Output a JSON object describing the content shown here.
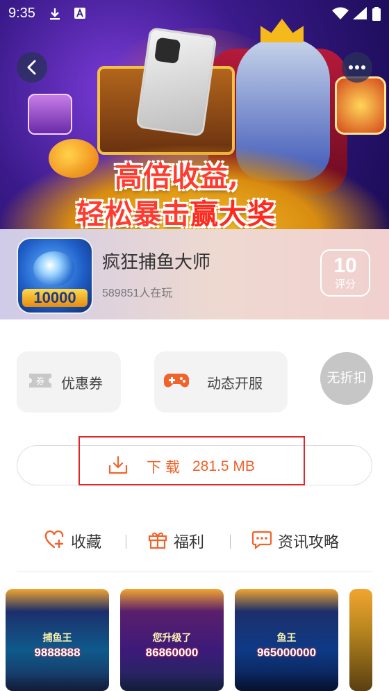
{
  "status_bar": {
    "time": "9:35"
  },
  "hero": {
    "slogan_line1": "高倍收益,",
    "slogan_line2_a": "轻松暴击",
    "slogan_line2_b": "赢大奖"
  },
  "app": {
    "name": "疯狂捕鱼大师",
    "players": "589851人在玩",
    "icon_badge": "10000",
    "score": "10",
    "score_label": "评分"
  },
  "features": {
    "coupon_label": "优惠券",
    "server_label": "动态开服",
    "no_discount_label": "无折扣"
  },
  "download": {
    "label": "下载",
    "size": "281.5 MB"
  },
  "tabs": [
    {
      "label": "收藏",
      "icon": "heart-plus-icon"
    },
    {
      "label": "福利",
      "icon": "gift-icon"
    },
    {
      "label": "资讯攻略",
      "icon": "chat-bubble-icon"
    }
  ],
  "screenshots": [
    {
      "sub": "捕鱼王",
      "big": "9888888"
    },
    {
      "sub": "您升级了",
      "big": "86860000"
    },
    {
      "sub": "鱼王",
      "big": "965000000"
    }
  ],
  "colors": {
    "accent": "#f0632b",
    "highlight_box": "#e0262a"
  }
}
